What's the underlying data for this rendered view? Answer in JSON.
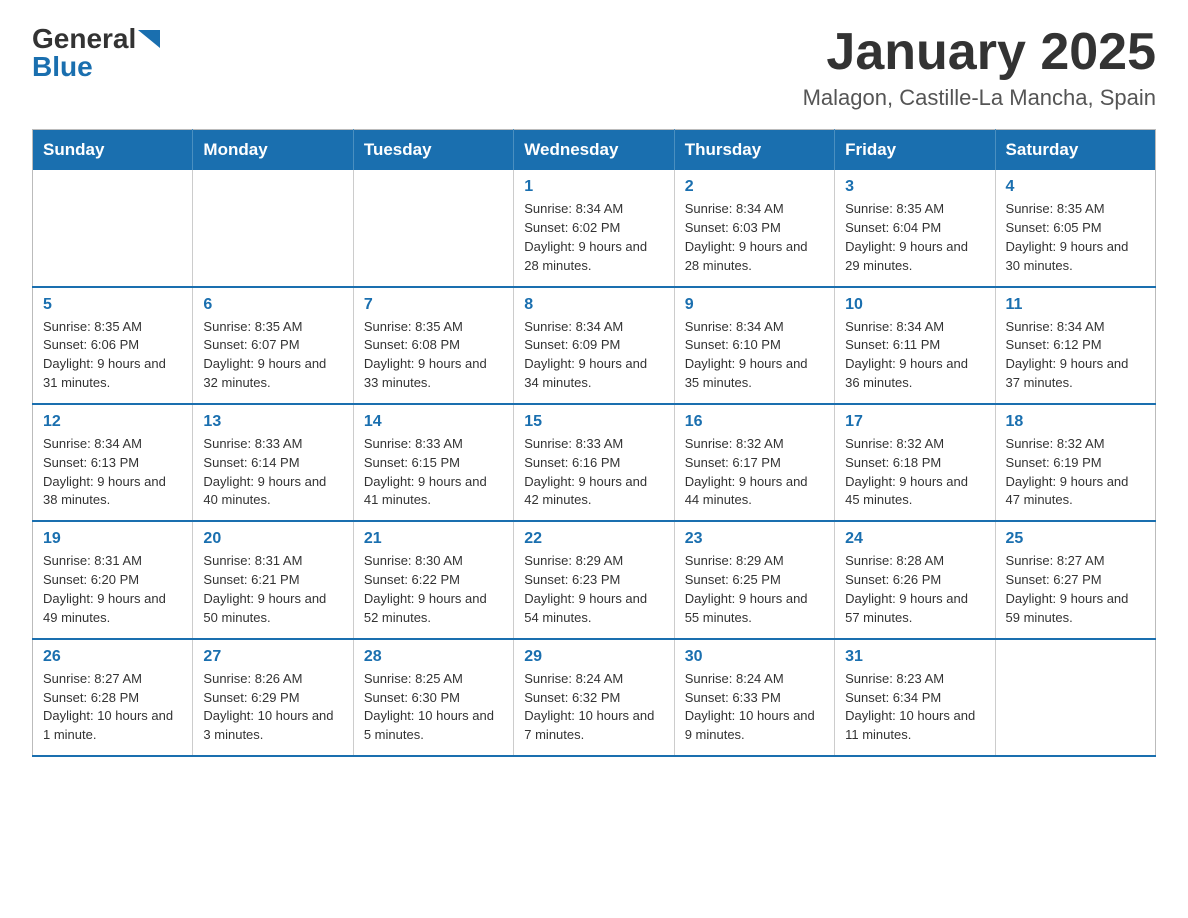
{
  "header": {
    "logo_general": "General",
    "logo_blue": "Blue",
    "month_title": "January 2025",
    "location": "Malagon, Castille-La Mancha, Spain"
  },
  "weekdays": [
    "Sunday",
    "Monday",
    "Tuesday",
    "Wednesday",
    "Thursday",
    "Friday",
    "Saturday"
  ],
  "weeks": [
    [
      {
        "day": "",
        "info": ""
      },
      {
        "day": "",
        "info": ""
      },
      {
        "day": "",
        "info": ""
      },
      {
        "day": "1",
        "info": "Sunrise: 8:34 AM\nSunset: 6:02 PM\nDaylight: 9 hours and 28 minutes."
      },
      {
        "day": "2",
        "info": "Sunrise: 8:34 AM\nSunset: 6:03 PM\nDaylight: 9 hours and 28 minutes."
      },
      {
        "day": "3",
        "info": "Sunrise: 8:35 AM\nSunset: 6:04 PM\nDaylight: 9 hours and 29 minutes."
      },
      {
        "day": "4",
        "info": "Sunrise: 8:35 AM\nSunset: 6:05 PM\nDaylight: 9 hours and 30 minutes."
      }
    ],
    [
      {
        "day": "5",
        "info": "Sunrise: 8:35 AM\nSunset: 6:06 PM\nDaylight: 9 hours and 31 minutes."
      },
      {
        "day": "6",
        "info": "Sunrise: 8:35 AM\nSunset: 6:07 PM\nDaylight: 9 hours and 32 minutes."
      },
      {
        "day": "7",
        "info": "Sunrise: 8:35 AM\nSunset: 6:08 PM\nDaylight: 9 hours and 33 minutes."
      },
      {
        "day": "8",
        "info": "Sunrise: 8:34 AM\nSunset: 6:09 PM\nDaylight: 9 hours and 34 minutes."
      },
      {
        "day": "9",
        "info": "Sunrise: 8:34 AM\nSunset: 6:10 PM\nDaylight: 9 hours and 35 minutes."
      },
      {
        "day": "10",
        "info": "Sunrise: 8:34 AM\nSunset: 6:11 PM\nDaylight: 9 hours and 36 minutes."
      },
      {
        "day": "11",
        "info": "Sunrise: 8:34 AM\nSunset: 6:12 PM\nDaylight: 9 hours and 37 minutes."
      }
    ],
    [
      {
        "day": "12",
        "info": "Sunrise: 8:34 AM\nSunset: 6:13 PM\nDaylight: 9 hours and 38 minutes."
      },
      {
        "day": "13",
        "info": "Sunrise: 8:33 AM\nSunset: 6:14 PM\nDaylight: 9 hours and 40 minutes."
      },
      {
        "day": "14",
        "info": "Sunrise: 8:33 AM\nSunset: 6:15 PM\nDaylight: 9 hours and 41 minutes."
      },
      {
        "day": "15",
        "info": "Sunrise: 8:33 AM\nSunset: 6:16 PM\nDaylight: 9 hours and 42 minutes."
      },
      {
        "day": "16",
        "info": "Sunrise: 8:32 AM\nSunset: 6:17 PM\nDaylight: 9 hours and 44 minutes."
      },
      {
        "day": "17",
        "info": "Sunrise: 8:32 AM\nSunset: 6:18 PM\nDaylight: 9 hours and 45 minutes."
      },
      {
        "day": "18",
        "info": "Sunrise: 8:32 AM\nSunset: 6:19 PM\nDaylight: 9 hours and 47 minutes."
      }
    ],
    [
      {
        "day": "19",
        "info": "Sunrise: 8:31 AM\nSunset: 6:20 PM\nDaylight: 9 hours and 49 minutes."
      },
      {
        "day": "20",
        "info": "Sunrise: 8:31 AM\nSunset: 6:21 PM\nDaylight: 9 hours and 50 minutes."
      },
      {
        "day": "21",
        "info": "Sunrise: 8:30 AM\nSunset: 6:22 PM\nDaylight: 9 hours and 52 minutes."
      },
      {
        "day": "22",
        "info": "Sunrise: 8:29 AM\nSunset: 6:23 PM\nDaylight: 9 hours and 54 minutes."
      },
      {
        "day": "23",
        "info": "Sunrise: 8:29 AM\nSunset: 6:25 PM\nDaylight: 9 hours and 55 minutes."
      },
      {
        "day": "24",
        "info": "Sunrise: 8:28 AM\nSunset: 6:26 PM\nDaylight: 9 hours and 57 minutes."
      },
      {
        "day": "25",
        "info": "Sunrise: 8:27 AM\nSunset: 6:27 PM\nDaylight: 9 hours and 59 minutes."
      }
    ],
    [
      {
        "day": "26",
        "info": "Sunrise: 8:27 AM\nSunset: 6:28 PM\nDaylight: 10 hours and 1 minute."
      },
      {
        "day": "27",
        "info": "Sunrise: 8:26 AM\nSunset: 6:29 PM\nDaylight: 10 hours and 3 minutes."
      },
      {
        "day": "28",
        "info": "Sunrise: 8:25 AM\nSunset: 6:30 PM\nDaylight: 10 hours and 5 minutes."
      },
      {
        "day": "29",
        "info": "Sunrise: 8:24 AM\nSunset: 6:32 PM\nDaylight: 10 hours and 7 minutes."
      },
      {
        "day": "30",
        "info": "Sunrise: 8:24 AM\nSunset: 6:33 PM\nDaylight: 10 hours and 9 minutes."
      },
      {
        "day": "31",
        "info": "Sunrise: 8:23 AM\nSunset: 6:34 PM\nDaylight: 10 hours and 11 minutes."
      },
      {
        "day": "",
        "info": ""
      }
    ]
  ]
}
